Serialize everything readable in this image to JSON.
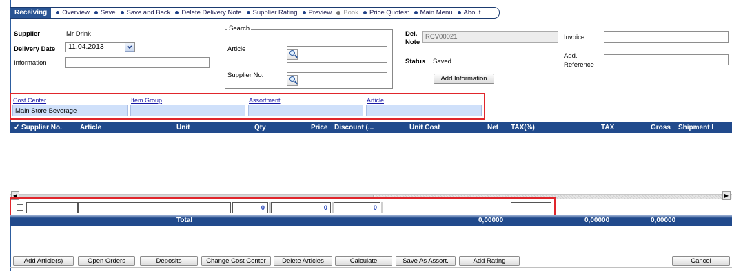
{
  "nav": {
    "active": "Receiving",
    "items": [
      {
        "label": "Overview",
        "disabled": false
      },
      {
        "label": "Save",
        "disabled": false
      },
      {
        "label": "Save and Back",
        "disabled": false
      },
      {
        "label": "Delete Delivery Note",
        "disabled": false
      },
      {
        "label": "Supplier Rating",
        "disabled": false
      },
      {
        "label": "Preview",
        "disabled": false
      },
      {
        "label": "Book",
        "disabled": true
      },
      {
        "label": "Price Quotes:",
        "disabled": false
      },
      {
        "label": "Main Menu",
        "disabled": false
      },
      {
        "label": "About",
        "disabled": false
      }
    ]
  },
  "form": {
    "supplier_label": "Supplier",
    "supplier_value": "Mr Drink",
    "delivery_date_label": "Delivery Date",
    "delivery_date_value": "11.04.2013",
    "information_label": "Information",
    "information_value": "",
    "search_group_title": "Search",
    "article_label": "Article",
    "article_value": "",
    "supplier_no_label": "Supplier No.",
    "supplier_no_value": "",
    "del_note_label_1": "Del.",
    "del_note_label_2": "Note",
    "del_note_value": "RCV00021",
    "status_label": "Status",
    "status_value": "Saved",
    "add_information_label": "Add Information",
    "invoice_label": "Invoice",
    "invoice_value": "",
    "add_reference_label_1": "Add.",
    "add_reference_label_2": "Reference",
    "add_reference_value": ""
  },
  "filters": {
    "cost_center_label": "Cost Center",
    "cost_center_value": "Main Store Beverage",
    "item_group_label": "Item Group",
    "item_group_value": "",
    "assortment_label": "Assortment",
    "assortment_value": "",
    "article_label": "Article",
    "article_value": ""
  },
  "grid": {
    "check_header": "✓",
    "columns": [
      "Supplier No.",
      "Article",
      "Unit",
      "Qty",
      "Price",
      "Discount (...",
      "Unit Cost",
      "Net",
      "TAX(%)",
      "TAX",
      "Gross",
      "Shipment I"
    ],
    "rows": []
  },
  "entry_row": {
    "qty": "0",
    "price": "0",
    "discount": "0"
  },
  "totals": {
    "label": "Total",
    "net": "0,00000",
    "tax": "0,00000",
    "gross": "0,00000"
  },
  "buttons": {
    "add_articles": "Add Article(s)",
    "open_orders": "Open Orders",
    "deposits": "Deposits",
    "change_cost_center": "Change Cost Center",
    "delete_articles": "Delete Articles",
    "calculate": "Calculate",
    "save_as_assort": "Save As Assort.",
    "add_rating": "Add Rating",
    "cancel": "Cancel"
  },
  "colors": {
    "header_blue": "#214a8c",
    "filter_fill": "#cfe0fa",
    "highlight_red": "#e0262c",
    "link_blue": "#1a1aa6"
  }
}
